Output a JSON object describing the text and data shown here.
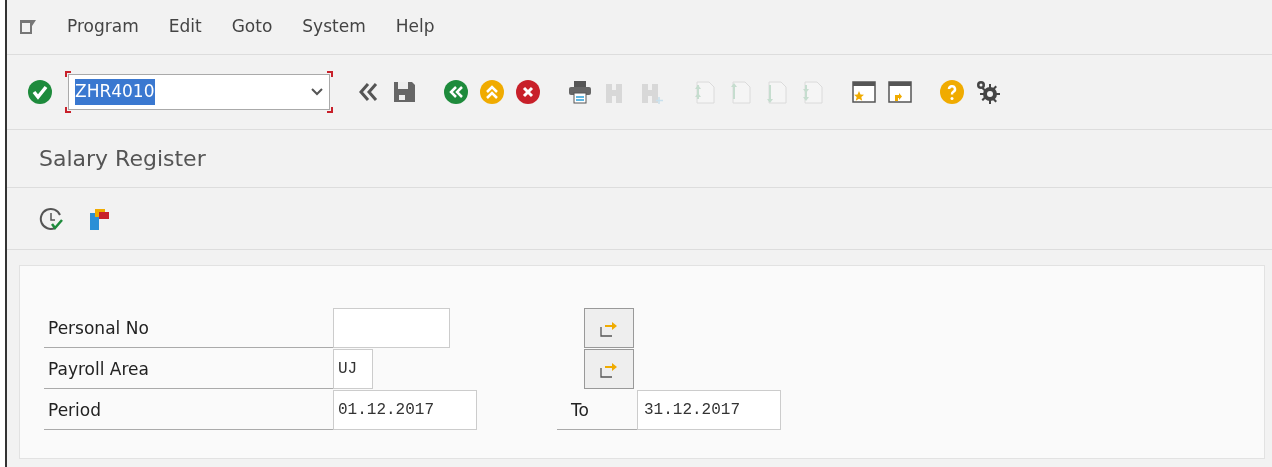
{
  "menu": [
    {
      "label": "Program"
    },
    {
      "label": "Edit"
    },
    {
      "label": "Goto"
    },
    {
      "label": "System"
    },
    {
      "label": "Help"
    }
  ],
  "command_field": {
    "value": "ZHR4010",
    "highlighted": true
  },
  "toolbar": [
    {
      "kind": "enter",
      "disabled": false
    },
    {
      "kind": "field"
    },
    {
      "kind": "back-arrows",
      "disabled": false
    },
    {
      "kind": "save",
      "disabled": false
    },
    {
      "kind": "back",
      "disabled": false
    },
    {
      "kind": "exit",
      "disabled": false
    },
    {
      "kind": "cancel",
      "disabled": false
    },
    {
      "kind": "print",
      "disabled": false
    },
    {
      "kind": "find",
      "disabled": true
    },
    {
      "kind": "find-next",
      "disabled": true
    },
    {
      "kind": "first-page",
      "disabled": true
    },
    {
      "kind": "prev-page",
      "disabled": true
    },
    {
      "kind": "next-page",
      "disabled": true
    },
    {
      "kind": "last-page",
      "disabled": true
    },
    {
      "kind": "new-session",
      "disabled": false
    },
    {
      "kind": "shortcut",
      "disabled": false
    },
    {
      "kind": "help",
      "disabled": false
    },
    {
      "kind": "settings",
      "disabled": false
    }
  ],
  "title": "Salary Register",
  "app_toolbar": [
    {
      "kind": "execute"
    },
    {
      "kind": "variant"
    }
  ],
  "fields": [
    {
      "label": "Personal No",
      "multiple_selection": true
    },
    {
      "label": "Payroll Area",
      "value": "UJ",
      "multiple_selection": true
    },
    {
      "label": "Period",
      "value": "01.12.2017",
      "multiple_selection": false,
      "to_label": "To",
      "to_value": "31.12.2017"
    }
  ]
}
